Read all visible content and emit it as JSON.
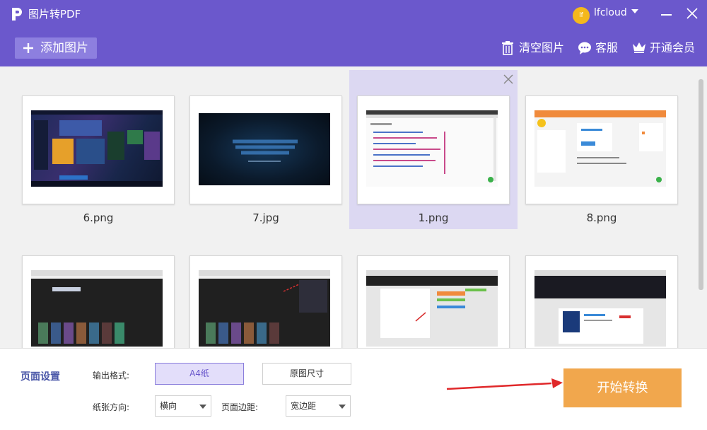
{
  "app": {
    "title": "图片转PDF"
  },
  "user": {
    "avatar_initial": "lf",
    "name": "lfcloud"
  },
  "toolbar": {
    "add_label": "添加图片",
    "clear_label": "清空图片",
    "service_label": "客服",
    "vip_label": "开通会员"
  },
  "images": [
    {
      "name": "6.png",
      "thumb": "dark-game",
      "selected": false
    },
    {
      "name": "7.jpg",
      "thumb": "blizzard",
      "selected": false
    },
    {
      "name": "1.png",
      "thumb": "web-list",
      "selected": true
    },
    {
      "name": "8.png",
      "thumb": "orange-dashboard",
      "selected": false
    },
    {
      "name": "",
      "thumb": "dark-website",
      "selected": false
    },
    {
      "name": "",
      "thumb": "dark-website",
      "selected": false
    },
    {
      "name": "",
      "thumb": "forum-page",
      "selected": false
    },
    {
      "name": "",
      "thumb": "card-page",
      "selected": false
    }
  ],
  "settings": {
    "section_title": "页面设置",
    "output_format_label": "输出格式:",
    "format_a4": "A4纸",
    "format_original": "原图尺寸",
    "orientation_label": "纸张方向:",
    "orientation_value": "横向",
    "margin_label": "页面边距:",
    "margin_value": "宽边距",
    "convert_label": "开始转换"
  },
  "colors": {
    "header": "#6b58cc",
    "accent_button": "#f1a74d",
    "selected_tile": "#dcd8f2",
    "section_title": "#4a57a8"
  }
}
